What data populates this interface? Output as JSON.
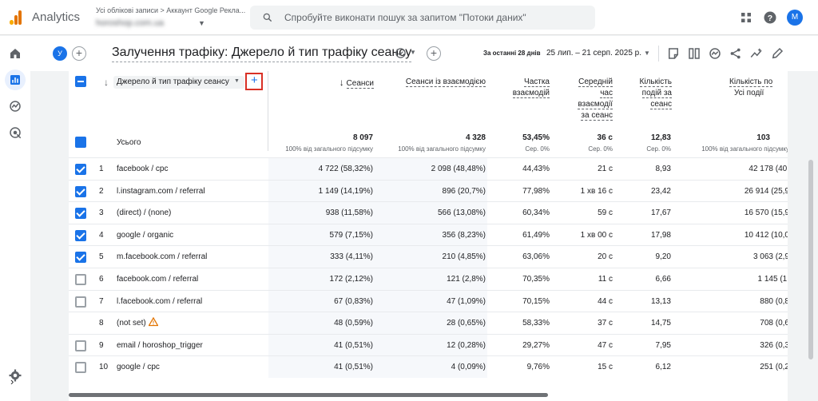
{
  "app": {
    "name": "Analytics",
    "breadcrumb": "Усі облікові записи > Аккаунт Google Рекла...",
    "account": "horoshop.com.ua"
  },
  "search": {
    "placeholder": "Спробуйте виконати пошук за запитом \"Потоки даних\""
  },
  "report": {
    "user_chip": "У",
    "title": "Залучення трафіку: Джерело й тип трафіку сеансу",
    "date_label": "За останні 28 днів",
    "date_range": "25 лип. – 21 серп. 2025 р."
  },
  "avatar": "M",
  "table": {
    "dimension": "Джерело й тип трафіку сеансу",
    "add_dimension": "+",
    "columns": [
      {
        "label": "Сеанси",
        "sorted": true
      },
      {
        "label": "Сеанси із взаємодією"
      },
      {
        "label": "Частка взаємодій"
      },
      {
        "label": "Середній час взаємодії за сеанс"
      },
      {
        "label": "Кількість подій за сеанс"
      },
      {
        "label": "Кількість по",
        "sub": "Усі події"
      }
    ],
    "total_label": "Усього",
    "totals": [
      {
        "v": "8 097",
        "s": "100% від загального підсумку"
      },
      {
        "v": "4 328",
        "s": "100% від загального підсумку"
      },
      {
        "v": "53,45%",
        "s": "Сер. 0%"
      },
      {
        "v": "36 с",
        "s": "Сер. 0%"
      },
      {
        "v": "12,83",
        "s": "Сер. 0%"
      },
      {
        "v": "103",
        "s": "100% від загального підсумку"
      }
    ],
    "rows": [
      {
        "n": "1",
        "name": "facebook / cpc",
        "checked": true,
        "c": [
          "4 722 (58,32%)",
          "2 098 (48,48%)",
          "44,43%",
          "21 с",
          "8,93",
          "42 178 (40,"
        ]
      },
      {
        "n": "2",
        "name": "l.instagram.com / referral",
        "checked": true,
        "c": [
          "1 149 (14,19%)",
          "896 (20,7%)",
          "77,98%",
          "1 хв 16 с",
          "23,42",
          "26 914 (25,9"
        ]
      },
      {
        "n": "3",
        "name": "(direct) / (none)",
        "checked": true,
        "c": [
          "938 (11,58%)",
          "566 (13,08%)",
          "60,34%",
          "59 с",
          "17,67",
          "16 570 (15,9"
        ]
      },
      {
        "n": "4",
        "name": "google / organic",
        "checked": true,
        "c": [
          "579 (7,15%)",
          "356 (8,23%)",
          "61,49%",
          "1 хв 00 с",
          "17,98",
          "10 412 (10,0"
        ]
      },
      {
        "n": "5",
        "name": "m.facebook.com / referral",
        "checked": true,
        "c": [
          "333 (4,11%)",
          "210 (4,85%)",
          "63,06%",
          "20 с",
          "9,20",
          "3 063 (2,9"
        ]
      },
      {
        "n": "6",
        "name": "facebook.com / referral",
        "checked": false,
        "c": [
          "172 (2,12%)",
          "121 (2,8%)",
          "70,35%",
          "11 с",
          "6,66",
          "1 145 (1,"
        ]
      },
      {
        "n": "7",
        "name": "l.facebook.com / referral",
        "checked": false,
        "c": [
          "67 (0,83%)",
          "47 (1,09%)",
          "70,15%",
          "44 с",
          "13,13",
          "880 (0,8"
        ]
      },
      {
        "n": "8",
        "name": "(not set)",
        "checked": null,
        "warning": true,
        "c": [
          "48 (0,59%)",
          "28 (0,65%)",
          "58,33%",
          "37 с",
          "14,75",
          "708 (0,6"
        ]
      },
      {
        "n": "9",
        "name": "email / horoshop_trigger",
        "checked": false,
        "c": [
          "41 (0,51%)",
          "12 (0,28%)",
          "29,27%",
          "47 с",
          "7,95",
          "326 (0,3"
        ]
      },
      {
        "n": "10",
        "name": "google / cpc",
        "checked": false,
        "c": [
          "41 (0,51%)",
          "4 (0,09%)",
          "9,76%",
          "15 с",
          "6,12",
          "251 (0,2"
        ]
      }
    ]
  }
}
